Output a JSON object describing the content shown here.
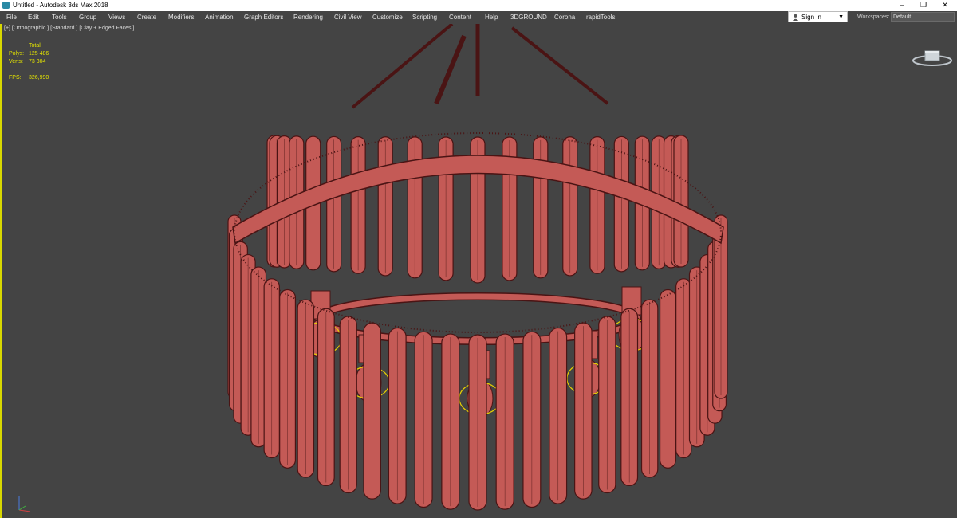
{
  "window": {
    "title": "Untitled - Autodesk 3ds Max 2018",
    "minimize": "–",
    "restore": "❐",
    "close": "✕"
  },
  "menu": [
    "File",
    "Edit",
    "Tools",
    "Group",
    "Views",
    "Create",
    "Modifiers",
    "Animation",
    "Graph Editors",
    "Rendering",
    "Civil View",
    "Customize",
    "Scripting",
    "Content",
    "Help",
    "3DGROUND",
    "Corona",
    "rapidTools"
  ],
  "signin": {
    "label": "Sign In",
    "icon": "user-icon"
  },
  "workspaces": {
    "label": "Workspaces:",
    "value": "Default"
  },
  "viewport": {
    "label": "[+] [Orthographic ] [Standard ] [Clay + Edged Faces ]",
    "stats": {
      "header": "Total",
      "polys_label": "Polys:",
      "polys": "125 486",
      "verts_label": "Verts:",
      "verts": "73 304",
      "fps_label": "FPS:",
      "fps": "326,990"
    }
  },
  "colors": {
    "background": "#444444",
    "active_border": "#d8d800",
    "stats_text": "#e5e500",
    "model_fill": "#c45a56",
    "model_edge": "#4a1414",
    "light_gizmo": "#e8d000"
  }
}
